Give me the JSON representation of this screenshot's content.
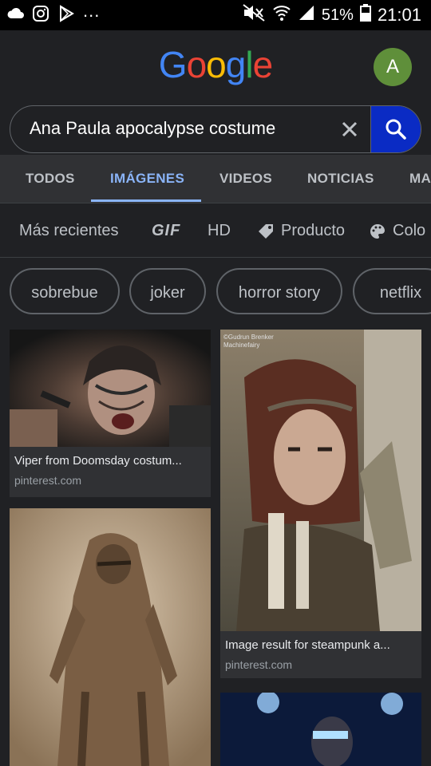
{
  "status_bar": {
    "left_icons": [
      "cloud-icon",
      "instagram-icon",
      "play-store-icon"
    ],
    "dots": "...",
    "battery_percent": "51%",
    "time": "21:01"
  },
  "header": {
    "logo": [
      "G",
      "o",
      "o",
      "g",
      "l",
      "e"
    ],
    "logo_colors": [
      "#4285f4",
      "#ea4335",
      "#fbbc05",
      "#4285f4",
      "#34a853",
      "#ea4335"
    ],
    "avatar_letter": "A",
    "avatar_color": "#5f8f3a"
  },
  "search": {
    "query": "Ana Paula apocalypse costume",
    "button_color": "#0a2bc4"
  },
  "tabs": [
    {
      "label": "TODOS"
    },
    {
      "label": "IMÁGENES",
      "active": true
    },
    {
      "label": "VIDEOS"
    },
    {
      "label": "NOTICIAS"
    },
    {
      "label": "MA"
    }
  ],
  "filters": [
    {
      "label": "Más recientes"
    },
    {
      "label": "GIF"
    },
    {
      "label": "HD"
    },
    {
      "label": "Producto",
      "icon": "tag-icon"
    },
    {
      "label": "Colo",
      "icon": "palette-icon"
    }
  ],
  "chips": [
    {
      "label": "sobrebue"
    },
    {
      "label": "joker"
    },
    {
      "label": "horror story"
    },
    {
      "label": "netflix"
    }
  ],
  "results": [
    {
      "title": "Viper from Doomsday costum...",
      "source": "pinterest.com"
    },
    {
      "title": "Image result for steampunk a...",
      "source": "pinterest.com",
      "watermark": "©Gudrun Brenker\nMachinefairy"
    },
    {
      "title": "",
      "source": ""
    },
    {
      "title": "",
      "source": ""
    }
  ]
}
